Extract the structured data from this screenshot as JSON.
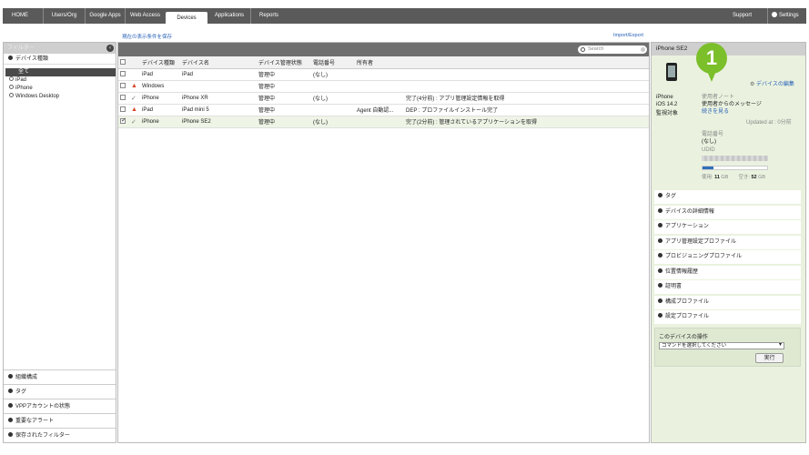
{
  "nav": {
    "tabs": [
      "HOME",
      "Users/Org",
      "Google Apps",
      "Web Access",
      "Devices",
      "Applications",
      "Reports"
    ],
    "active": "Devices",
    "support": "Support",
    "settings": "Settings"
  },
  "links": {
    "save_view": "現在の表示条件を保存",
    "import_export": "Import/Export"
  },
  "left": {
    "header": "フィルター",
    "collapse_icon": "‹",
    "section_device_type": "デバイス種類",
    "items": [
      "全て",
      "iPad",
      "iPhone",
      "Windows Desktop"
    ],
    "bottom": [
      "組織構成",
      "タグ",
      "VPPアカウントの状態",
      "重要なアラート",
      "保存されたフィルター"
    ]
  },
  "search": {
    "placeholder": "Search"
  },
  "table": {
    "headers": [
      "デバイス種類",
      "デバイス名",
      "デバイス管理状態",
      "電話番号",
      "所有者",
      ""
    ],
    "rows": [
      {
        "status": "",
        "type": "iPad",
        "name": "iPad",
        "mgmt": "管理中",
        "phone": "(なし)",
        "owner": "",
        "info": ""
      },
      {
        "status": "▲",
        "type": "Windows",
        "name": "",
        "mgmt": "管理中",
        "phone": "",
        "owner": "",
        "info": ""
      },
      {
        "status": "✓",
        "type": "iPhone",
        "name": "iPhone XR",
        "mgmt": "管理中",
        "phone": "(なし)",
        "owner": "",
        "info": "完了(4分前) : アプリ管理設定情報を取得"
      },
      {
        "status": "▲",
        "type": "iPad",
        "name": "iPad mini 5",
        "mgmt": "管理中",
        "phone": "",
        "owner": "Agent 自動認...",
        "info": "DEP : プロファイルインストール完了"
      },
      {
        "status": "✓",
        "type": "iPhone",
        "name": "iPhone SE2",
        "mgmt": "管理中",
        "phone": "(なし)",
        "owner": "",
        "info": "完了(2分前) : 管理されているアプリケーションを取得"
      }
    ]
  },
  "detail": {
    "header": "iPhone SE2",
    "badge": "1",
    "model": "iPhone",
    "os": "iOS 14.2",
    "supervised": "監視対象",
    "edit_link": "デバイスの編集",
    "note_label": "使用者ノート",
    "note_value": "使用者からのメッセージ",
    "note_more": "続きを見る",
    "updated": "Updated at : 0分前",
    "phone_label": "電話番号",
    "phone_value": "(なし)",
    "udid_label": "UDID",
    "storage_used_label": "使用:",
    "storage_used": "11",
    "storage_free_label": "空き:",
    "storage_free": "52",
    "storage_unit": "GB",
    "storage_used_fraction": 0.17,
    "sections": [
      "タグ",
      "デバイスの詳細情報",
      "アプリケーション",
      "アプリ管理設定プロファイル",
      "プロビジョニングプロファイル",
      "位置情報履歴",
      "証明書",
      "構成プロファイル",
      "設定プロファイル"
    ],
    "ops_title": "このデバイスの操作",
    "ops_select": "コマンドを選択してください",
    "ops_run": "実行"
  },
  "colors": {
    "accent": "#7bbf2a",
    "link": "#2a62b8",
    "warning": "#d9442b",
    "panel": "#eaf2df"
  }
}
